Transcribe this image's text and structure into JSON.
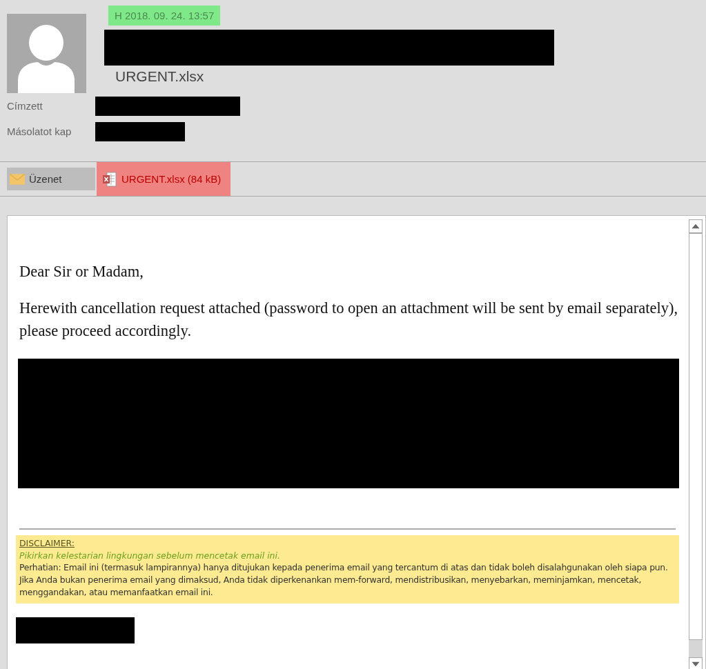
{
  "header": {
    "date": "H 2018. 09. 24.  13:57",
    "subject": "URGENT.xlsx",
    "fields": [
      {
        "label": "Címzett"
      },
      {
        "label": "Másolatot kap"
      }
    ]
  },
  "tabs": [
    {
      "label": "Üzenet",
      "kind": "message",
      "selected": true
    },
    {
      "label": "URGENT.xlsx (84 kB)",
      "kind": "attachment",
      "selected": false
    }
  ],
  "body": {
    "greeting": "Dear Sir or Madam,",
    "paragraph": "Herewith cancellation request attached (password to open an attachment will be sent by email separately), please proceed accordingly.",
    "disclaimer": {
      "heading": "DISCLAIMER:",
      "note": "Pikirkan kelestarian lingkungan sebelum mencetak email ini.",
      "text": "Perhatian: Email ini (termasuk lampirannya) hanya ditujukan kepada penerima email yang tercantum di atas dan tidak boleh disalahgunakan oleh siapa pun. Jika Anda bukan penerima email yang dimaksud, Anda tidak diperkenankan mem-forward, mendistribusikan, menyebarkan, meminjamkan, mencetak, menggandakan, atau memanfaatkan email ini."
    }
  }
}
